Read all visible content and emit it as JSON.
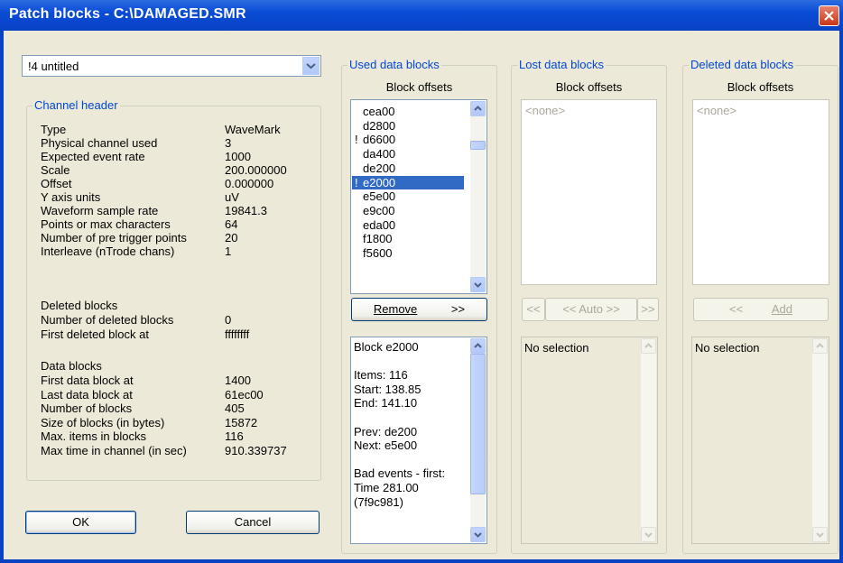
{
  "window": {
    "title": "Patch blocks - C:\\DAMAGED.SMR"
  },
  "channel_select": {
    "value": "!4 untitled"
  },
  "channel_header": {
    "legend": "Channel header",
    "rows": [
      {
        "label": "Type",
        "value": "WaveMark"
      },
      {
        "label": "Physical channel used",
        "value": "3"
      },
      {
        "label": "Expected event rate",
        "value": "1000"
      },
      {
        "label": "Scale",
        "value": "200.000000"
      },
      {
        "label": "Offset",
        "value": "0.000000"
      },
      {
        "label": "Y axis units",
        "value": "uV"
      },
      {
        "label": "Waveform sample rate",
        "value": "19841.3"
      },
      {
        "label": "Points or max characters",
        "value": "64"
      },
      {
        "label": "Number of pre trigger points",
        "value": "20"
      },
      {
        "label": "Interleave (nTrode chans)",
        "value": "1"
      }
    ],
    "deleted_title": "Deleted blocks",
    "deleted_rows": [
      {
        "label": "Number of deleted blocks",
        "value": "0"
      },
      {
        "label": "First deleted block at",
        "value": "ffffffff"
      }
    ],
    "data_title": "Data blocks",
    "data_rows": [
      {
        "label": "First data block at",
        "value": "1400"
      },
      {
        "label": "Last data block at",
        "value": "61ec00"
      },
      {
        "label": "Number of blocks",
        "value": "405"
      },
      {
        "label": "Size of blocks (in bytes)",
        "value": "15872"
      },
      {
        "label": "Max. items in blocks",
        "value": "116"
      },
      {
        "label": "Max time in channel (in sec)",
        "value": "910.339737"
      }
    ]
  },
  "buttons": {
    "ok": "OK",
    "cancel": "Cancel",
    "remove": "Remove",
    "remove_arrows": ">>",
    "prev": "<<",
    "auto": "<< Auto >>",
    "next": ">>",
    "add_arrows": "<<",
    "add": "Add"
  },
  "used": {
    "legend": "Used data blocks",
    "header": "Block offsets",
    "items": [
      {
        "mark": "",
        "text": "cea00"
      },
      {
        "mark": "",
        "text": "d2800"
      },
      {
        "mark": "!",
        "text": "d6600"
      },
      {
        "mark": "",
        "text": "da400"
      },
      {
        "mark": "",
        "text": "de200"
      },
      {
        "mark": "!",
        "text": "e2000"
      },
      {
        "mark": "",
        "text": "e5e00"
      },
      {
        "mark": "",
        "text": "e9c00"
      },
      {
        "mark": "",
        "text": "eda00"
      },
      {
        "mark": "",
        "text": "f1800"
      },
      {
        "mark": "",
        "text": "f5600"
      }
    ],
    "selected": "e2000",
    "info": [
      "Block e2000",
      "",
      "Items: 116",
      "Start: 138.85",
      "End: 141.10",
      "",
      "Prev: de200",
      "Next: e5e00",
      "",
      "Bad events - first:",
      "Time 281.00",
      "(7f9c981)"
    ]
  },
  "lost": {
    "legend": "Lost data blocks",
    "header": "Block offsets",
    "empty": "<none>",
    "info": "No selection"
  },
  "deleted": {
    "legend": "Deleted data blocks",
    "header": "Block offsets",
    "empty": "<none>",
    "info": "No selection"
  },
  "colors": {
    "titlebar": "#0842C3",
    "dialog_bg": "#ECE9D8",
    "selection": "#316AC5",
    "legend_text": "#0046D5"
  }
}
